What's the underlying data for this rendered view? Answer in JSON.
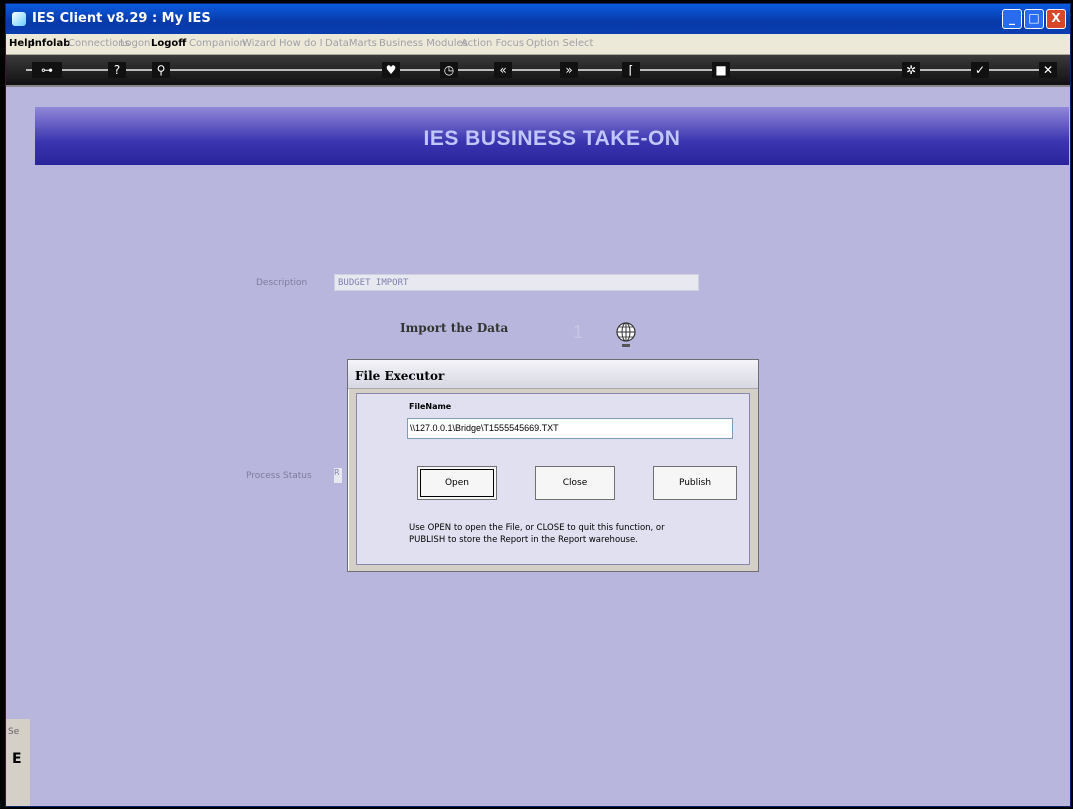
{
  "window": {
    "title": "IES Client v8.29 : My IES",
    "controls": {
      "minimize": "_",
      "maximize": "□",
      "close": "X"
    }
  },
  "menu": {
    "items": [
      "Help",
      "Infolab",
      "Connections",
      "Logon",
      "Logoff",
      "Companion",
      "Wizard",
      "How do I",
      "DataMarts",
      "Business Modules",
      "Action Focus",
      "Option Select"
    ]
  },
  "toolbar": {
    "icons": [
      "key-icon",
      "help-icon",
      "search-icon",
      "heart-icon",
      "clock-icon",
      "rewind-icon",
      "forward-icon",
      "bracket-icon",
      "stop-icon",
      "settings-icon",
      "check-icon",
      "close-icon"
    ]
  },
  "header": {
    "title": "IES BUSINESS TAKE-ON"
  },
  "form": {
    "description_label": "Description",
    "description_value": "BUDGET IMPORT",
    "import_label": "Import the Data",
    "step_number": "1",
    "process_status_label": "Process Status",
    "process_status_value": "R"
  },
  "dialog": {
    "title": "File Executor",
    "filename_label": "FileName",
    "filename_value": "\\\\127.0.0.1\\Bridge\\T1555545669.TXT",
    "open_label": "Open",
    "close_label": "Close",
    "publish_label": "Publish",
    "help_line1": "Use OPEN to open the File, or CLOSE to quit this function, or",
    "help_line2": "PUBLISH to store the Report in the Report warehouse."
  },
  "side": {
    "label1": "Se",
    "label2": "E"
  }
}
